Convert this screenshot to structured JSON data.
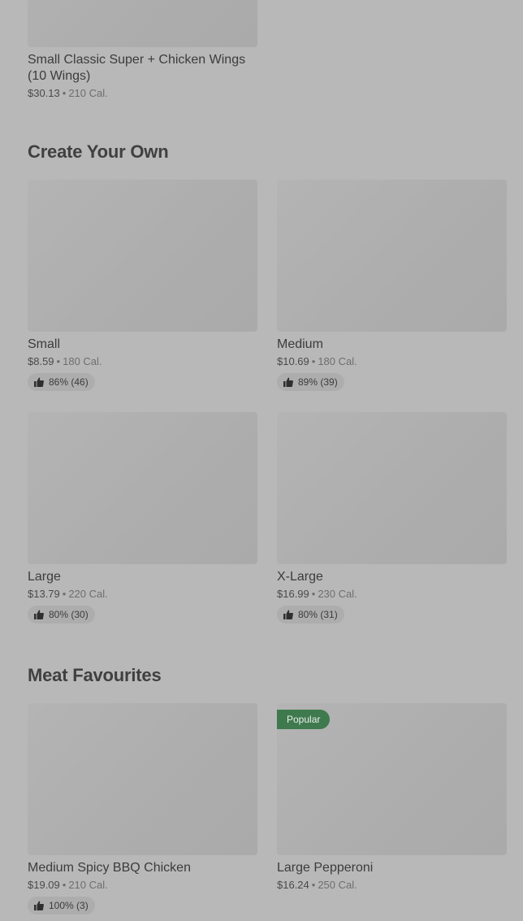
{
  "top_card": {
    "title": "Small Classic Super + Chicken Wings (10 Wings)",
    "price": "$30.13",
    "calories": "210 Cal."
  },
  "sections": [
    {
      "title": "Create Your Own",
      "items": [
        {
          "title": "Small",
          "price": "$8.59",
          "calories": "180 Cal.",
          "rating": "86% (46)"
        },
        {
          "title": "Medium",
          "price": "$10.69",
          "calories": "180 Cal.",
          "rating": "89% (39)"
        },
        {
          "title": "Large",
          "price": "$13.79",
          "calories": "220 Cal.",
          "rating": "80% (30)"
        },
        {
          "title": "X-Large",
          "price": "$16.99",
          "calories": "230 Cal.",
          "rating": "80% (31)"
        }
      ]
    },
    {
      "title": "Meat Favourites",
      "items": [
        {
          "title": "Medium Spicy BBQ Chicken",
          "price": "$19.09",
          "calories": "210 Cal.",
          "rating": "100% (3)"
        },
        {
          "title": "Large Pepperoni",
          "price": "$16.24",
          "calories": "250 Cal.",
          "badge": "Popular"
        }
      ]
    }
  ],
  "separator": "•",
  "colors": {
    "overlay_background": "#b8b8b8",
    "popular_badge": "#3f7a4e"
  }
}
